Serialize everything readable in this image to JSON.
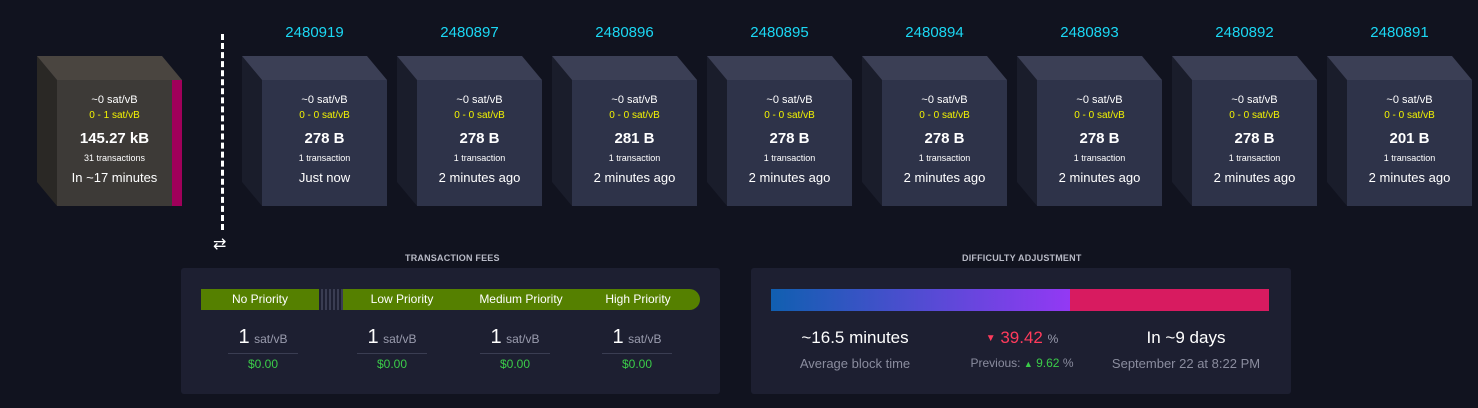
{
  "mempool": {
    "fee": "~0 sat/vB",
    "range": "0 - 1 sat/vB",
    "size": "145.27 kB",
    "tx": "31 transactions",
    "eta": "In ~17 minutes"
  },
  "blocks": [
    {
      "height": "2480919",
      "fee": "~0 sat/vB",
      "range": "0 - 0 sat/vB",
      "size": "278 B",
      "tx": "1 transaction",
      "time": "Just now"
    },
    {
      "height": "2480897",
      "fee": "~0 sat/vB",
      "range": "0 - 0 sat/vB",
      "size": "278 B",
      "tx": "1 transaction",
      "time": "2 minutes ago"
    },
    {
      "height": "2480896",
      "fee": "~0 sat/vB",
      "range": "0 - 0 sat/vB",
      "size": "281 B",
      "tx": "1 transaction",
      "time": "2 minutes ago"
    },
    {
      "height": "2480895",
      "fee": "~0 sat/vB",
      "range": "0 - 0 sat/vB",
      "size": "278 B",
      "tx": "1 transaction",
      "time": "2 minutes ago"
    },
    {
      "height": "2480894",
      "fee": "~0 sat/vB",
      "range": "0 - 0 sat/vB",
      "size": "278 B",
      "tx": "1 transaction",
      "time": "2 minutes ago"
    },
    {
      "height": "2480893",
      "fee": "~0 sat/vB",
      "range": "0 - 0 sat/vB",
      "size": "278 B",
      "tx": "1 transaction",
      "time": "2 minutes ago"
    },
    {
      "height": "2480892",
      "fee": "~0 sat/vB",
      "range": "0 - 0 sat/vB",
      "size": "278 B",
      "tx": "1 transaction",
      "time": "2 minutes ago"
    },
    {
      "height": "2480891",
      "fee": "~0 sat/vB",
      "range": "0 - 0 sat/vB",
      "size": "201 B",
      "tx": "1 transaction",
      "time": "2 minutes ago"
    }
  ],
  "fees": {
    "title": "TRANSACTION FEES",
    "labels": {
      "none": "No Priority",
      "low": "Low Priority",
      "medium": "Medium Priority",
      "high": "High Priority"
    },
    "unit": "sat/vB",
    "values": [
      {
        "val": "1",
        "usd": "$0.00"
      },
      {
        "val": "1",
        "usd": "$0.00"
      },
      {
        "val": "1",
        "usd": "$0.00"
      },
      {
        "val": "1",
        "usd": "$0.00"
      }
    ]
  },
  "difficulty": {
    "title": "DIFFICULTY ADJUSTMENT",
    "progress_percent": 60,
    "avg_time": "~16.5 minutes",
    "avg_label": "Average block time",
    "change": "39.42",
    "change_unit": "%",
    "prev_label": "Previous:",
    "prev_value": "9.62",
    "prev_unit": "%",
    "eta": "In ~9 days",
    "eta_date": "September 22 at 8:22 PM"
  },
  "colors": {
    "accent_height": "#1bd8f4",
    "fee_range": "#f5f500",
    "fee_bar": "#558000",
    "down": "#ff3b5c",
    "up": "#3bcc49"
  }
}
